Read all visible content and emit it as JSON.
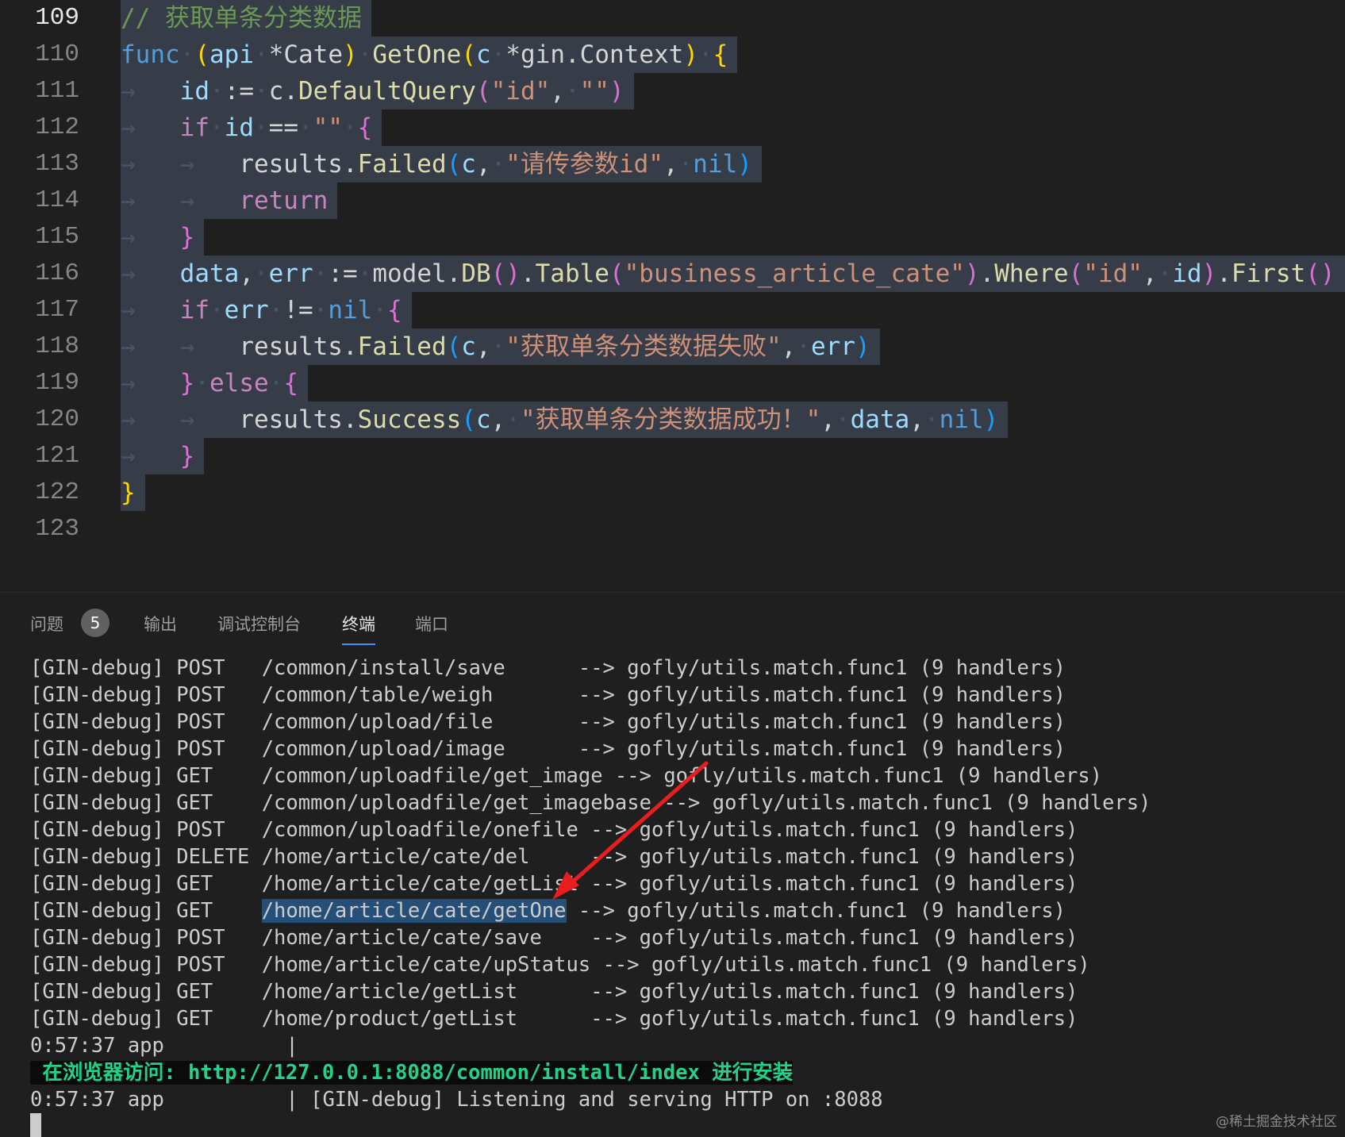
{
  "editor": {
    "lines": [
      {
        "num": "109",
        "current": true,
        "tokens": [
          [
            "cm",
            "// 获取单条分类数据"
          ]
        ]
      },
      {
        "num": "110",
        "tokens": [
          [
            "kw",
            "func"
          ],
          [
            "ws",
            "·"
          ],
          [
            "b1",
            "("
          ],
          [
            "var",
            "api"
          ],
          [
            "ws",
            "·"
          ],
          [
            "pl",
            "*Cate"
          ],
          [
            "b1",
            ")"
          ],
          [
            "ws",
            "·"
          ],
          [
            "fn",
            "GetOne"
          ],
          [
            "b1",
            "("
          ],
          [
            "var",
            "c"
          ],
          [
            "ws",
            "·"
          ],
          [
            "pl",
            "*gin.Context"
          ],
          [
            "b1",
            ")"
          ],
          [
            "ws",
            "·"
          ],
          [
            "b1",
            "{"
          ]
        ]
      },
      {
        "num": "111",
        "tokens": [
          [
            "ws",
            "→   "
          ],
          [
            "var",
            "id"
          ],
          [
            "ws",
            "·"
          ],
          [
            "pl",
            ":="
          ],
          [
            "ws",
            "·"
          ],
          [
            "pl",
            "c."
          ],
          [
            "fn",
            "DefaultQuery"
          ],
          [
            "b2",
            "("
          ],
          [
            "str",
            "\"id\""
          ],
          [
            "pl",
            ","
          ],
          [
            "ws",
            "·"
          ],
          [
            "str",
            "\"\""
          ],
          [
            "b2",
            ")"
          ]
        ]
      },
      {
        "num": "112",
        "tokens": [
          [
            "ws",
            "→   "
          ],
          [
            "ctl",
            "if"
          ],
          [
            "ws",
            "·"
          ],
          [
            "var",
            "id"
          ],
          [
            "ws",
            "·"
          ],
          [
            "pl",
            "=="
          ],
          [
            "ws",
            "·"
          ],
          [
            "str",
            "\"\""
          ],
          [
            "ws",
            "·"
          ],
          [
            "b2",
            "{"
          ]
        ]
      },
      {
        "num": "113",
        "tokens": [
          [
            "ws",
            "→   →   "
          ],
          [
            "pl",
            "results."
          ],
          [
            "fn",
            "Failed"
          ],
          [
            "b3",
            "("
          ],
          [
            "var",
            "c"
          ],
          [
            "pl",
            ","
          ],
          [
            "ws",
            "·"
          ],
          [
            "str",
            "\"请传参数id\""
          ],
          [
            "pl",
            ","
          ],
          [
            "ws",
            "·"
          ],
          [
            "kw",
            "nil"
          ],
          [
            "b3",
            ")"
          ]
        ]
      },
      {
        "num": "114",
        "tokens": [
          [
            "ws",
            "→   →   "
          ],
          [
            "ctl",
            "return"
          ]
        ]
      },
      {
        "num": "115",
        "tokens": [
          [
            "ws",
            "→   "
          ],
          [
            "b2",
            "}"
          ]
        ]
      },
      {
        "num": "116",
        "tokens": [
          [
            "ws",
            "→   "
          ],
          [
            "var",
            "data"
          ],
          [
            "pl",
            ","
          ],
          [
            "ws",
            "·"
          ],
          [
            "var",
            "err"
          ],
          [
            "ws",
            "·"
          ],
          [
            "pl",
            ":="
          ],
          [
            "ws",
            "·"
          ],
          [
            "pl",
            "model."
          ],
          [
            "fn",
            "DB"
          ],
          [
            "b2",
            "()"
          ],
          [
            "pl",
            "."
          ],
          [
            "fn",
            "Table"
          ],
          [
            "b2",
            "("
          ],
          [
            "str",
            "\"business_article_cate\""
          ],
          [
            "b2",
            ")"
          ],
          [
            "pl",
            "."
          ],
          [
            "fn",
            "Where"
          ],
          [
            "b2",
            "("
          ],
          [
            "str",
            "\"id\""
          ],
          [
            "pl",
            ","
          ],
          [
            "ws",
            "·"
          ],
          [
            "var",
            "id"
          ],
          [
            "b2",
            ")"
          ],
          [
            "pl",
            "."
          ],
          [
            "fn",
            "First"
          ],
          [
            "b2",
            "()"
          ]
        ]
      },
      {
        "num": "117",
        "tokens": [
          [
            "ws",
            "→   "
          ],
          [
            "ctl",
            "if"
          ],
          [
            "ws",
            "·"
          ],
          [
            "var",
            "err"
          ],
          [
            "ws",
            "·"
          ],
          [
            "pl",
            "!="
          ],
          [
            "ws",
            "·"
          ],
          [
            "kw",
            "nil"
          ],
          [
            "ws",
            "·"
          ],
          [
            "b2",
            "{"
          ]
        ]
      },
      {
        "num": "118",
        "tokens": [
          [
            "ws",
            "→   →   "
          ],
          [
            "pl",
            "results."
          ],
          [
            "fn",
            "Failed"
          ],
          [
            "b3",
            "("
          ],
          [
            "var",
            "c"
          ],
          [
            "pl",
            ","
          ],
          [
            "ws",
            "·"
          ],
          [
            "str",
            "\"获取单条分类数据失败\""
          ],
          [
            "pl",
            ","
          ],
          [
            "ws",
            "·"
          ],
          [
            "var",
            "err"
          ],
          [
            "b3",
            ")"
          ]
        ]
      },
      {
        "num": "119",
        "tokens": [
          [
            "ws",
            "→   "
          ],
          [
            "b2",
            "}"
          ],
          [
            "ws",
            "·"
          ],
          [
            "ctl",
            "else"
          ],
          [
            "ws",
            "·"
          ],
          [
            "b2",
            "{"
          ]
        ]
      },
      {
        "num": "120",
        "tokens": [
          [
            "ws",
            "→   →   "
          ],
          [
            "pl",
            "results."
          ],
          [
            "fn",
            "Success"
          ],
          [
            "b3",
            "("
          ],
          [
            "var",
            "c"
          ],
          [
            "pl",
            ","
          ],
          [
            "ws",
            "·"
          ],
          [
            "str",
            "\"获取单条分类数据成功！\""
          ],
          [
            "pl",
            ","
          ],
          [
            "ws",
            "·"
          ],
          [
            "var",
            "data"
          ],
          [
            "pl",
            ","
          ],
          [
            "ws",
            "·"
          ],
          [
            "kw",
            "nil"
          ],
          [
            "b3",
            ")"
          ]
        ]
      },
      {
        "num": "121",
        "tokens": [
          [
            "ws",
            "→   "
          ],
          [
            "b2",
            "}"
          ]
        ]
      },
      {
        "num": "122",
        "tokens": [
          [
            "b1",
            "}"
          ]
        ]
      },
      {
        "num": "123",
        "tokens": []
      }
    ]
  },
  "panel": {
    "tabs": [
      {
        "label": "问题",
        "active": false
      },
      {
        "label": "输出",
        "active": false
      },
      {
        "label": "调试控制台",
        "active": false
      },
      {
        "label": "终端",
        "active": true
      },
      {
        "label": "端口",
        "active": false
      }
    ],
    "problems_count": "5"
  },
  "terminal": {
    "lines": [
      {
        "text": "[GIN-debug] POST   /common/install/save      --> gofly/utils.match.func1 (9 handlers)"
      },
      {
        "text": "[GIN-debug] POST   /common/table/weigh       --> gofly/utils.match.func1 (9 handlers)"
      },
      {
        "text": "[GIN-debug] POST   /common/upload/file       --> gofly/utils.match.func1 (9 handlers)"
      },
      {
        "text": "[GIN-debug] POST   /common/upload/image      --> gofly/utils.match.func1 (9 handlers)"
      },
      {
        "text": "[GIN-debug] GET    /common/uploadfile/get_image --> gofly/utils.match.func1 (9 handlers)"
      },
      {
        "text": "[GIN-debug] GET    /common/uploadfile/get_imagebase --> gofly/utils.match.func1 (9 handlers)"
      },
      {
        "text": "[GIN-debug] POST   /common/uploadfile/onefile --> gofly/utils.match.func1 (9 handlers)"
      },
      {
        "text": "[GIN-debug] DELETE /home/article/cate/del     --> gofly/utils.match.func1 (9 handlers)"
      },
      {
        "text": "[GIN-debug] GET    /home/article/cate/getList --> gofly/utils.match.func1 (9 handlers)"
      },
      {
        "pre": "[GIN-debug] GET    ",
        "highlight": "/home/article/cate/getOne",
        "post": " --> gofly/utils.match.func1 (9 handlers)"
      },
      {
        "text": "[GIN-debug] POST   /home/article/cate/save    --> gofly/utils.match.func1 (9 handlers)"
      },
      {
        "text": "[GIN-debug] POST   /home/article/cate/upStatus --> gofly/utils.match.func1 (9 handlers)"
      },
      {
        "text": "[GIN-debug] GET    /home/article/getList      --> gofly/utils.match.func1 (9 handlers)"
      },
      {
        "text": "[GIN-debug] GET    /home/product/getList      --> gofly/utils.match.func1 (9 handlers)"
      },
      {
        "text": "0:57:37 app          |"
      },
      {
        "green": " 在浏览器访问: http://127.0.0.1:8088/common/install/index 进行安装"
      },
      {
        "text": "0:57:37 app          | [GIN-debug] Listening and serving HTTP on :8088"
      }
    ]
  },
  "watermark": "@稀土掘金技术社区",
  "colors": {
    "arrow": "#e81e1e",
    "selection": "#264f78",
    "active_tab_underline": "#3794ff"
  }
}
